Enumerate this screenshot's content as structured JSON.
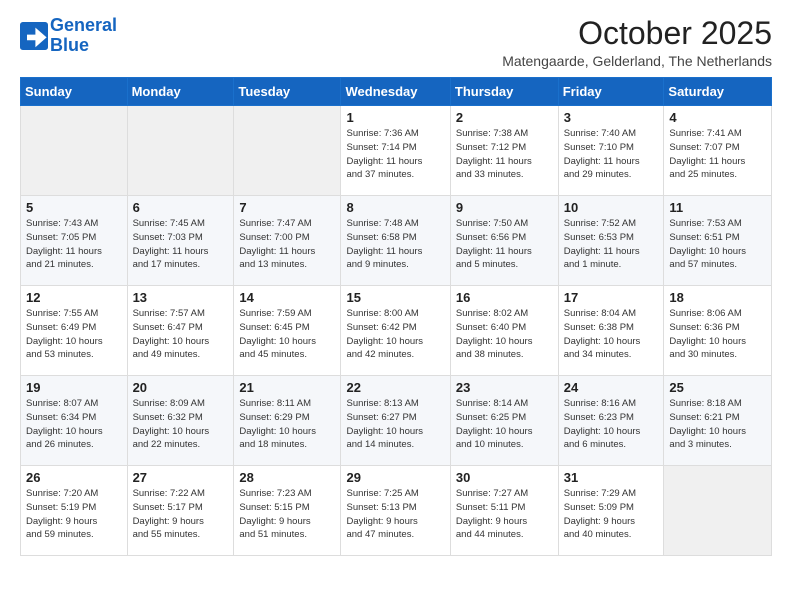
{
  "logo": {
    "line1": "General",
    "line2": "Blue"
  },
  "title": "October 2025",
  "location": "Matengaarde, Gelderland, The Netherlands",
  "weekdays": [
    "Sunday",
    "Monday",
    "Tuesday",
    "Wednesday",
    "Thursday",
    "Friday",
    "Saturday"
  ],
  "weeks": [
    [
      {
        "day": "",
        "info": ""
      },
      {
        "day": "",
        "info": ""
      },
      {
        "day": "",
        "info": ""
      },
      {
        "day": "1",
        "info": "Sunrise: 7:36 AM\nSunset: 7:14 PM\nDaylight: 11 hours\nand 37 minutes."
      },
      {
        "day": "2",
        "info": "Sunrise: 7:38 AM\nSunset: 7:12 PM\nDaylight: 11 hours\nand 33 minutes."
      },
      {
        "day": "3",
        "info": "Sunrise: 7:40 AM\nSunset: 7:10 PM\nDaylight: 11 hours\nand 29 minutes."
      },
      {
        "day": "4",
        "info": "Sunrise: 7:41 AM\nSunset: 7:07 PM\nDaylight: 11 hours\nand 25 minutes."
      }
    ],
    [
      {
        "day": "5",
        "info": "Sunrise: 7:43 AM\nSunset: 7:05 PM\nDaylight: 11 hours\nand 21 minutes."
      },
      {
        "day": "6",
        "info": "Sunrise: 7:45 AM\nSunset: 7:03 PM\nDaylight: 11 hours\nand 17 minutes."
      },
      {
        "day": "7",
        "info": "Sunrise: 7:47 AM\nSunset: 7:00 PM\nDaylight: 11 hours\nand 13 minutes."
      },
      {
        "day": "8",
        "info": "Sunrise: 7:48 AM\nSunset: 6:58 PM\nDaylight: 11 hours\nand 9 minutes."
      },
      {
        "day": "9",
        "info": "Sunrise: 7:50 AM\nSunset: 6:56 PM\nDaylight: 11 hours\nand 5 minutes."
      },
      {
        "day": "10",
        "info": "Sunrise: 7:52 AM\nSunset: 6:53 PM\nDaylight: 11 hours\nand 1 minute."
      },
      {
        "day": "11",
        "info": "Sunrise: 7:53 AM\nSunset: 6:51 PM\nDaylight: 10 hours\nand 57 minutes."
      }
    ],
    [
      {
        "day": "12",
        "info": "Sunrise: 7:55 AM\nSunset: 6:49 PM\nDaylight: 10 hours\nand 53 minutes."
      },
      {
        "day": "13",
        "info": "Sunrise: 7:57 AM\nSunset: 6:47 PM\nDaylight: 10 hours\nand 49 minutes."
      },
      {
        "day": "14",
        "info": "Sunrise: 7:59 AM\nSunset: 6:45 PM\nDaylight: 10 hours\nand 45 minutes."
      },
      {
        "day": "15",
        "info": "Sunrise: 8:00 AM\nSunset: 6:42 PM\nDaylight: 10 hours\nand 42 minutes."
      },
      {
        "day": "16",
        "info": "Sunrise: 8:02 AM\nSunset: 6:40 PM\nDaylight: 10 hours\nand 38 minutes."
      },
      {
        "day": "17",
        "info": "Sunrise: 8:04 AM\nSunset: 6:38 PM\nDaylight: 10 hours\nand 34 minutes."
      },
      {
        "day": "18",
        "info": "Sunrise: 8:06 AM\nSunset: 6:36 PM\nDaylight: 10 hours\nand 30 minutes."
      }
    ],
    [
      {
        "day": "19",
        "info": "Sunrise: 8:07 AM\nSunset: 6:34 PM\nDaylight: 10 hours\nand 26 minutes."
      },
      {
        "day": "20",
        "info": "Sunrise: 8:09 AM\nSunset: 6:32 PM\nDaylight: 10 hours\nand 22 minutes."
      },
      {
        "day": "21",
        "info": "Sunrise: 8:11 AM\nSunset: 6:29 PM\nDaylight: 10 hours\nand 18 minutes."
      },
      {
        "day": "22",
        "info": "Sunrise: 8:13 AM\nSunset: 6:27 PM\nDaylight: 10 hours\nand 14 minutes."
      },
      {
        "day": "23",
        "info": "Sunrise: 8:14 AM\nSunset: 6:25 PM\nDaylight: 10 hours\nand 10 minutes."
      },
      {
        "day": "24",
        "info": "Sunrise: 8:16 AM\nSunset: 6:23 PM\nDaylight: 10 hours\nand 6 minutes."
      },
      {
        "day": "25",
        "info": "Sunrise: 8:18 AM\nSunset: 6:21 PM\nDaylight: 10 hours\nand 3 minutes."
      }
    ],
    [
      {
        "day": "26",
        "info": "Sunrise: 7:20 AM\nSunset: 5:19 PM\nDaylight: 9 hours\nand 59 minutes."
      },
      {
        "day": "27",
        "info": "Sunrise: 7:22 AM\nSunset: 5:17 PM\nDaylight: 9 hours\nand 55 minutes."
      },
      {
        "day": "28",
        "info": "Sunrise: 7:23 AM\nSunset: 5:15 PM\nDaylight: 9 hours\nand 51 minutes."
      },
      {
        "day": "29",
        "info": "Sunrise: 7:25 AM\nSunset: 5:13 PM\nDaylight: 9 hours\nand 47 minutes."
      },
      {
        "day": "30",
        "info": "Sunrise: 7:27 AM\nSunset: 5:11 PM\nDaylight: 9 hours\nand 44 minutes."
      },
      {
        "day": "31",
        "info": "Sunrise: 7:29 AM\nSunset: 5:09 PM\nDaylight: 9 hours\nand 40 minutes."
      },
      {
        "day": "",
        "info": ""
      }
    ]
  ]
}
